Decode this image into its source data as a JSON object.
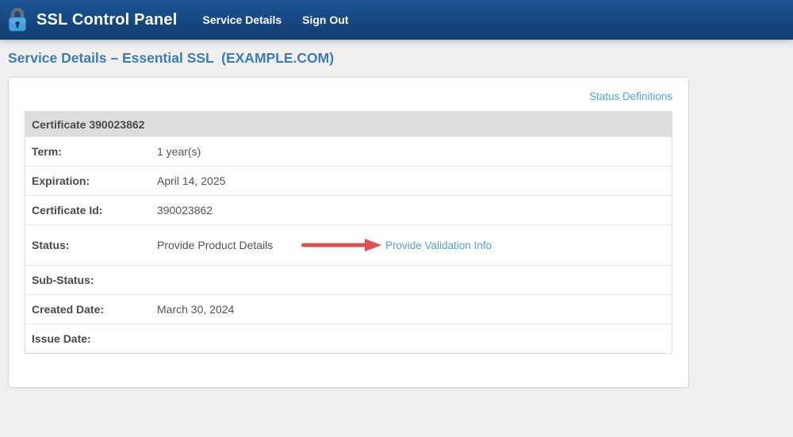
{
  "header": {
    "brand": "SSL Control Panel",
    "nav": [
      {
        "label": "Service Details"
      },
      {
        "label": "Sign Out"
      }
    ]
  },
  "page": {
    "title": "Service Details – Essential SSL  (EXAMPLE.COM)"
  },
  "panel": {
    "status_definitions_label": "Status Definitions"
  },
  "certificate": {
    "header": "Certificate 390023862",
    "rows": [
      {
        "label": "Term:",
        "value": "1 year(s)"
      },
      {
        "label": "Expiration:",
        "value": "April 14, 2025"
      },
      {
        "label": "Certificate Id:",
        "value": "390023862"
      },
      {
        "label": "Status:",
        "value": "Provide Product Details",
        "action_link": "Provide Validation Info"
      },
      {
        "label": "Sub-Status:",
        "value": ""
      },
      {
        "label": "Created Date:",
        "value": "March 30, 2024"
      },
      {
        "label": "Issue Date:",
        "value": ""
      }
    ]
  },
  "icons": {
    "lock": "lock-icon",
    "arrow": "red-annotation-arrow"
  },
  "colors": {
    "header_gradient_top": "#1d5492",
    "header_gradient_bottom": "#0f3e70",
    "page_background": "#f0f0f0",
    "title_blue": "#3d7cb2",
    "link_blue": "#4fa3e3",
    "table_header_bg": "#dcdcdc",
    "label_text": "#4a4a4a",
    "value_text": "#555555",
    "arrow_red": "#e0504f",
    "lock_body_blue": "#3f9ad8",
    "lock_shackle_gray": "#6e6e6e"
  }
}
